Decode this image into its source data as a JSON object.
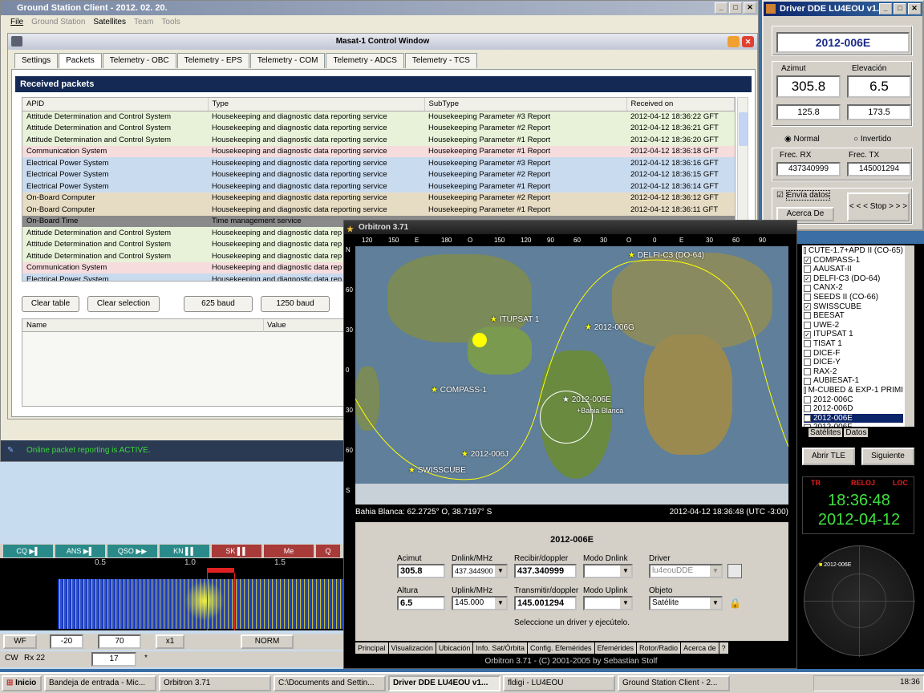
{
  "gsc": {
    "title": "Ground Station Client - 2012. 02. 20.",
    "menu": [
      "File",
      "Ground Station",
      "Satellites",
      "Team",
      "Tools"
    ],
    "control_window": "Masat-1 Control Window",
    "tabs": [
      "Settings",
      "Packets",
      "Telemetry - OBC",
      "Telemetry - EPS",
      "Telemetry - COM",
      "Telemetry - ADCS",
      "Telemetry - TCS"
    ],
    "section": "Received packets",
    "columns": [
      "APID",
      "Type",
      "SubType",
      "Received on"
    ],
    "rows": [
      [
        "Attitude Determination and Control System",
        "Housekeeping and diagnostic data reporting service",
        "Housekeeping Parameter #3 Report",
        "2012-04-12 18:36:22 GFT",
        "#e8f2d8"
      ],
      [
        "Attitude Determination and Control System",
        "Housekeeping and diagnostic data reporting service",
        "Housekeeping Parameter #2 Report",
        "2012-04-12 18:36:21 GFT",
        "#e8f2d8"
      ],
      [
        "Attitude Determination and Control System",
        "Housekeeping and diagnostic data reporting service",
        "Housekeeping Parameter #1 Report",
        "2012-04-12 18:36:20 GFT",
        "#e8f2d8"
      ],
      [
        "Communication System",
        "Housekeeping and diagnostic data reporting service",
        "Housekeeping Parameter #1 Report",
        "2012-04-12 18:36:18 GFT",
        "#f6dcdc"
      ],
      [
        "Electrical Power System",
        "Housekeeping and diagnostic data reporting service",
        "Housekeeping Parameter #3 Report",
        "2012-04-12 18:36:16 GFT",
        "#c9dbef"
      ],
      [
        "Electrical Power System",
        "Housekeeping and diagnostic data reporting service",
        "Housekeeping Parameter #2 Report",
        "2012-04-12 18:36:15 GFT",
        "#c9dbef"
      ],
      [
        "Electrical Power System",
        "Housekeeping and diagnostic data reporting service",
        "Housekeeping Parameter #1 Report",
        "2012-04-12 18:36:14 GFT",
        "#c9dbef"
      ],
      [
        "On-Board Computer",
        "Housekeeping and diagnostic data reporting service",
        "Housekeeping Parameter #2 Report",
        "2012-04-12 18:36:12 GFT",
        "#e6dcc4"
      ],
      [
        "On-Board Computer",
        "Housekeeping and diagnostic data reporting service",
        "Housekeeping Parameter #1 Report",
        "2012-04-12 18:36:11 GFT",
        "#e6dcc4"
      ],
      [
        "On-Board Time",
        "Time management service",
        "",
        "",
        "#8a8a8a"
      ],
      [
        "Attitude Determination and Control System",
        "Housekeeping and diagnostic data rep",
        "",
        "",
        "#e8f2d8"
      ],
      [
        "Attitude Determination and Control System",
        "Housekeeping and diagnostic data rep",
        "",
        "",
        "#e8f2d8"
      ],
      [
        "Attitude Determination and Control System",
        "Housekeeping and diagnostic data rep",
        "",
        "",
        "#e8f2d8"
      ],
      [
        "Communication System",
        "Housekeeping and diagnostic data rep",
        "",
        "",
        "#f6dcdc"
      ],
      [
        "Electrical Power System",
        "Housekeeping and diagnostic data rep",
        "",
        "",
        "#c9dbef"
      ]
    ],
    "buttons": [
      "Clear table",
      "Clear selection",
      "625 baud",
      "1250 baud"
    ],
    "detail_cols": [
      "Name",
      "Value"
    ],
    "status": "Online packet reporting is ACTIVE."
  },
  "dde": {
    "title": "Driver DDE LU4EOU v1.0",
    "sat": "2012-006E",
    "az_label": "Azimut",
    "el_label": "Elevación",
    "az": "305.8",
    "el": "6.5",
    "az2": "125.8",
    "el2": "173.5",
    "normal": "Normal",
    "invert": "Invertido",
    "rx_label": "Frec. RX",
    "tx_label": "Frec. TX",
    "rx": "437340999",
    "tx": "145001294",
    "send": "Envía datos",
    "about": "Acerca De",
    "stop": "< < < Stop > > >"
  },
  "orb": {
    "title": "Orbitron 3.71",
    "top_ticks": [
      "120",
      "150",
      "E",
      "180",
      "O",
      "150",
      "120",
      "90",
      "60",
      "30",
      "O",
      "0",
      "E",
      "30",
      "60",
      "90"
    ],
    "left_ticks": [
      "N",
      "60",
      "30",
      "0",
      "30",
      "60",
      "S"
    ],
    "sats_map": [
      "DELFI-C3 (DO-64)",
      "ITUPSAT 1",
      "2012-006G",
      "COMPASS-1",
      "2012-006E",
      "Bahia Blanca",
      "2012-006J",
      "SWISSCUBE"
    ],
    "loc_line": "Bahia Blanca: 62.2725° O, 38.7197° S",
    "time_line": "2012-04-12 18:36:48 (UTC -3:00)",
    "panel_sat": "2012-006E",
    "labels": {
      "az": "Acimut",
      "dl": "Dnlink/MHz",
      "rd": "Recibir/doppler",
      "md": "Modo Dnlink",
      "drv": "Driver",
      "alt": "Altura",
      "ul": "Uplink/MHz",
      "td": "Transmitir/doppler",
      "mu": "Modo Uplink",
      "obj": "Objeto"
    },
    "vals": {
      "az": "305.8",
      "dl": "437.344900",
      "rd": "437.340999",
      "drv": "lu4eouDDE",
      "alt": "6.5",
      "ul": "145.000",
      "td": "145.001294",
      "obj": "Satélite"
    },
    "hint": "Seleccione un driver y ejecútelo.",
    "tabs": [
      "Principal",
      "Visualización",
      "Ubicación",
      "Info. Sat/Órbita",
      "Config. Efemérides",
      "Efemérides",
      "Rotor/Radio",
      "Acerca de",
      "?"
    ],
    "footer": "Orbitron 3.71 - (C) 2001-2005 by Sebastian Stolf",
    "list": [
      [
        "CUTE-1.7+APD II (CO-65)",
        false
      ],
      [
        "COMPASS-1",
        true
      ],
      [
        "AAUSAT-II",
        false
      ],
      [
        "DELFI-C3 (DO-64)",
        true
      ],
      [
        "CANX-2",
        false
      ],
      [
        "SEEDS II (CO-66)",
        false
      ],
      [
        "SWISSCUBE",
        true
      ],
      [
        "BEESAT",
        false
      ],
      [
        "UWE-2",
        false
      ],
      [
        "ITUPSAT 1",
        true
      ],
      [
        "TISAT 1",
        false
      ],
      [
        "DICE-F",
        false
      ],
      [
        "DICE-Y",
        false
      ],
      [
        "RAX-2",
        false
      ],
      [
        "AUBIESAT-1",
        false
      ],
      [
        "M-CUBED & EXP-1 PRIMI",
        false
      ],
      [
        "2012-006C",
        false
      ],
      [
        "2012-006D",
        false
      ],
      [
        "2012-006E",
        true
      ],
      [
        "2012-006F",
        false
      ]
    ],
    "list_tabs": [
      "Satélites",
      "Datos"
    ],
    "abrir": "Abrir TLE",
    "sig": "Siguiente",
    "clock_labels": [
      "TR",
      "RELOJ",
      "LOC"
    ],
    "clock_time": "18:36:48",
    "clock_date": "2012-04-12",
    "radar_sat": "2012-006E"
  },
  "fl": {
    "buttons": [
      "CQ ▶▌",
      "ANS ▶▌",
      "QSO ▶▶",
      "KN ▌▌",
      "SK ▌▌",
      "Me",
      "Q"
    ],
    "scale": [
      "0.5",
      "1.0",
      "1.5"
    ],
    "bottom1": [
      "WF",
      "-20",
      "70",
      "x1",
      "NORM"
    ],
    "mode": "CW",
    "rx": "Rx 22",
    "val": "17",
    "star": "*"
  },
  "task": {
    "start": "Inicio",
    "items": [
      "Bandeja de entrada - Mic...",
      "Orbitron 3.71",
      "C:\\Documents and Settin...",
      "Driver DDE LU4EOU v1...",
      "fldigi - LU4EOU",
      "Ground Station Client - 2..."
    ],
    "clock": "18:36"
  }
}
